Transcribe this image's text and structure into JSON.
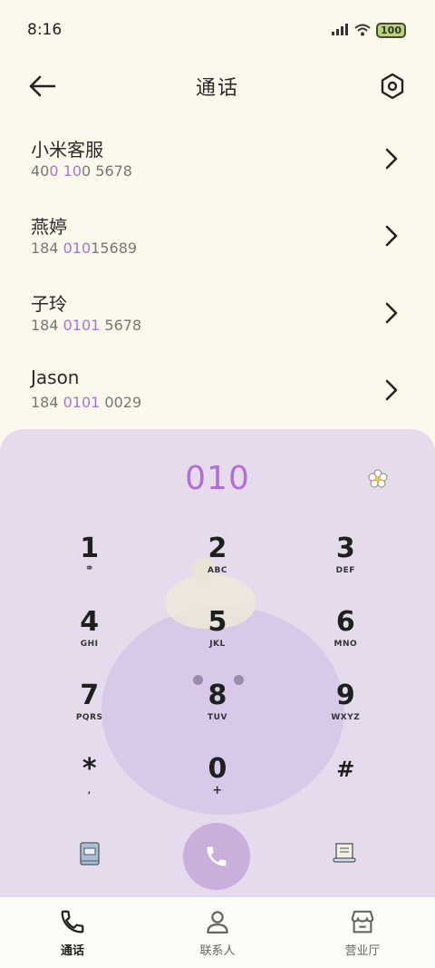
{
  "status_bar": {
    "time": "8:16",
    "battery": "100"
  },
  "header": {
    "title": "通话"
  },
  "contacts": [
    {
      "name": "小米客服",
      "number_parts": [
        "40",
        "0",
        " ",
        "10",
        "0 5678"
      ]
    },
    {
      "name": "燕婷",
      "number_parts": [
        "184 ",
        "010",
        "",
        "",
        "15689"
      ]
    },
    {
      "name": "子玲",
      "number_parts": [
        "184 ",
        "0101",
        "",
        "",
        " 5678"
      ]
    },
    {
      "name": "Jason",
      "number_parts": [
        "184 ",
        "0101",
        "",
        "",
        " 0029"
      ]
    }
  ],
  "dialer": {
    "input": "010",
    "keys": [
      {
        "digit": "1",
        "letters": ""
      },
      {
        "digit": "2",
        "letters": "ABC"
      },
      {
        "digit": "3",
        "letters": "DEF"
      },
      {
        "digit": "4",
        "letters": "GHI"
      },
      {
        "digit": "5",
        "letters": "JKL"
      },
      {
        "digit": "6",
        "letters": "MNO"
      },
      {
        "digit": "7",
        "letters": "PQRS"
      },
      {
        "digit": "8",
        "letters": "TUV"
      },
      {
        "digit": "9",
        "letters": "WXYZ"
      },
      {
        "digit": "*",
        "letters": ","
      },
      {
        "digit": "0",
        "letters": "+"
      },
      {
        "digit": "#",
        "letters": ""
      }
    ]
  },
  "tabs": [
    {
      "label": "通话",
      "icon": "phone-icon",
      "active": true
    },
    {
      "label": "联系人",
      "icon": "person-icon",
      "active": false
    },
    {
      "label": "营业厅",
      "icon": "store-icon",
      "active": false
    }
  ],
  "colors": {
    "accent": "#a874d4",
    "dialer_bg": "#e6dbed",
    "call_button": "#c9afdc"
  }
}
